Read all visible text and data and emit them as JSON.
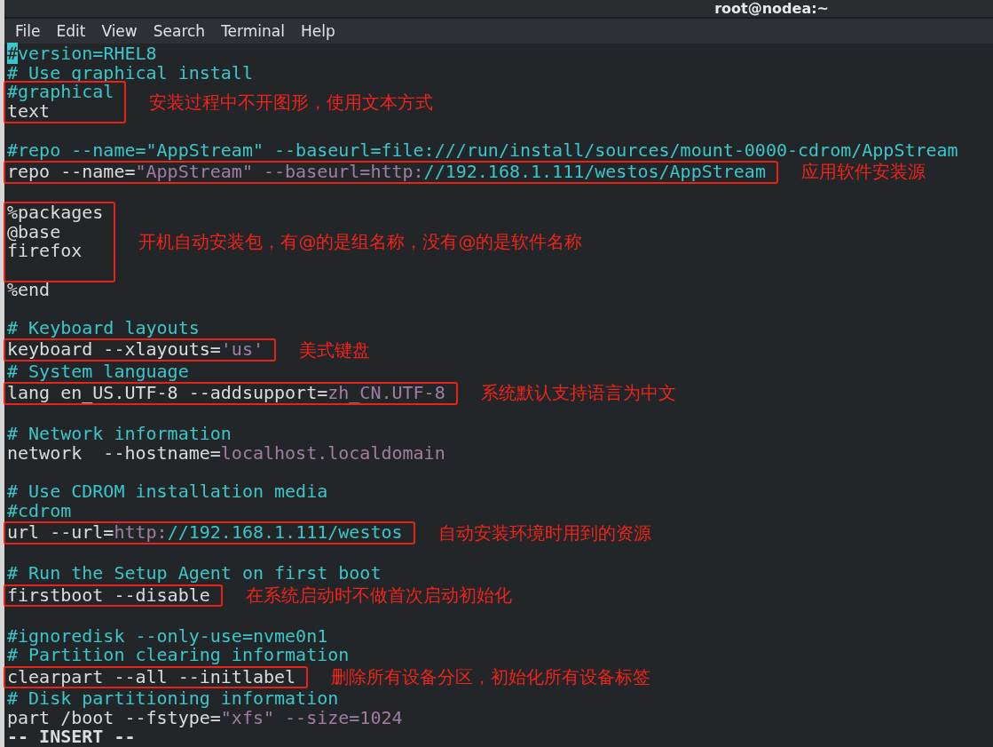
{
  "window": {
    "title": "root@nodea:~"
  },
  "menu": [
    "File",
    "Edit",
    "View",
    "Search",
    "Terminal",
    "Help"
  ],
  "editor": {
    "blocks": [
      {
        "lines": [
          {
            "kind": "code",
            "segments": [
              {
                "kind": "cursor",
                "text": "#"
              },
              {
                "kind": "comment",
                "text": "version=RHEL8"
              }
            ]
          },
          {
            "kind": "code",
            "segments": [
              {
                "kind": "comment",
                "text": "# Use graphical install"
              }
            ]
          }
        ]
      },
      {
        "note": "安装过程中不开图形，使用文本方式",
        "lines": [
          {
            "kind": "code",
            "segments": [
              {
                "kind": "comment",
                "text": "#graphical"
              }
            ]
          },
          {
            "kind": "code",
            "segments": [
              {
                "kind": "text",
                "text": "text"
              }
            ]
          }
        ]
      },
      {
        "lines": [
          {
            "kind": "blank"
          },
          {
            "kind": "code",
            "segments": [
              {
                "kind": "comment",
                "text": "#repo --name=\"AppStream\" --baseurl=file:///run/install/sources/mount-0000-cdrom/AppStream"
              }
            ]
          }
        ]
      },
      {
        "note": "应用软件安装源",
        "lines": [
          {
            "kind": "code",
            "segments": [
              {
                "kind": "text",
                "text": "repo --name="
              },
              {
                "kind": "string",
                "text": "\"AppStream\" --baseurl=http:"
              },
              {
                "kind": "comment",
                "text": "//192.168.1.111/westos/AppStream"
              }
            ]
          }
        ]
      },
      {
        "lines": [
          {
            "kind": "blank"
          }
        ]
      },
      {
        "note": "开机自动安装包，有@的是组名称，没有@的是软件名称",
        "lines": [
          {
            "kind": "code",
            "segments": [
              {
                "kind": "text",
                "text": "%packages"
              }
            ]
          },
          {
            "kind": "code",
            "segments": [
              {
                "kind": "text",
                "text": "@base"
              }
            ]
          },
          {
            "kind": "code",
            "segments": [
              {
                "kind": "text",
                "text": "firefox"
              }
            ]
          },
          {
            "kind": "blank"
          }
        ]
      },
      {
        "lines": [
          {
            "kind": "code",
            "segments": [
              {
                "kind": "text",
                "text": "%end"
              }
            ]
          },
          {
            "kind": "blank"
          },
          {
            "kind": "code",
            "segments": [
              {
                "kind": "comment",
                "text": "# Keyboard layouts"
              }
            ]
          }
        ]
      },
      {
        "note": "美式键盘",
        "lines": [
          {
            "kind": "code",
            "segments": [
              {
                "kind": "text",
                "text": "keyboard --xlayouts="
              },
              {
                "kind": "string",
                "text": "'us'"
              }
            ]
          }
        ]
      },
      {
        "lines": [
          {
            "kind": "code",
            "segments": [
              {
                "kind": "comment",
                "text": "# System language"
              }
            ]
          }
        ]
      },
      {
        "note": "系统默认支持语言为中文",
        "lines": [
          {
            "kind": "code",
            "segments": [
              {
                "kind": "text",
                "text": "lang en_US.UTF-8 --addsupport="
              },
              {
                "kind": "string",
                "text": "zh_CN.UTF-8"
              }
            ]
          }
        ]
      },
      {
        "lines": [
          {
            "kind": "blank"
          },
          {
            "kind": "code",
            "segments": [
              {
                "kind": "comment",
                "text": "# Network information"
              }
            ]
          },
          {
            "kind": "code",
            "segments": [
              {
                "kind": "text",
                "text": "network  --hostname="
              },
              {
                "kind": "string",
                "text": "localhost.localdomain"
              }
            ]
          },
          {
            "kind": "blank"
          },
          {
            "kind": "code",
            "segments": [
              {
                "kind": "comment",
                "text": "# Use CDROM installation media"
              }
            ]
          },
          {
            "kind": "code",
            "segments": [
              {
                "kind": "comment",
                "text": "#cdrom"
              }
            ]
          }
        ]
      },
      {
        "note": "自动安装环境时用到的资源",
        "lines": [
          {
            "kind": "code",
            "segments": [
              {
                "kind": "text",
                "text": "url --url="
              },
              {
                "kind": "string",
                "text": "http:"
              },
              {
                "kind": "comment",
                "text": "//192.168.1.111/westos"
              }
            ]
          }
        ]
      },
      {
        "lines": [
          {
            "kind": "blank"
          },
          {
            "kind": "code",
            "segments": [
              {
                "kind": "comment",
                "text": "# Run the Setup Agent on first boot"
              }
            ]
          }
        ]
      },
      {
        "note": "在系统启动时不做首次启动初始化",
        "lines": [
          {
            "kind": "code",
            "segments": [
              {
                "kind": "text",
                "text": "firstboot --disable"
              }
            ]
          }
        ]
      },
      {
        "lines": [
          {
            "kind": "blank"
          },
          {
            "kind": "code",
            "segments": [
              {
                "kind": "comment",
                "text": "#ignoredisk --only-use=nvme0n1"
              }
            ]
          },
          {
            "kind": "code",
            "segments": [
              {
                "kind": "comment",
                "text": "# Partition clearing information"
              }
            ]
          }
        ]
      },
      {
        "note": "删除所有设备分区，初始化所有设备标签",
        "lines": [
          {
            "kind": "code",
            "segments": [
              {
                "kind": "text",
                "text": "clearpart --all --initlabel"
              }
            ]
          }
        ]
      },
      {
        "lines": [
          {
            "kind": "code",
            "segments": [
              {
                "kind": "comment",
                "text": "# Disk partitioning information"
              }
            ]
          },
          {
            "kind": "code",
            "segments": [
              {
                "kind": "text",
                "text": "part /boot --fstype="
              },
              {
                "kind": "string",
                "text": "\"xfs\" --size=1024"
              }
            ]
          }
        ]
      }
    ]
  },
  "status_line": "-- INSERT --"
}
